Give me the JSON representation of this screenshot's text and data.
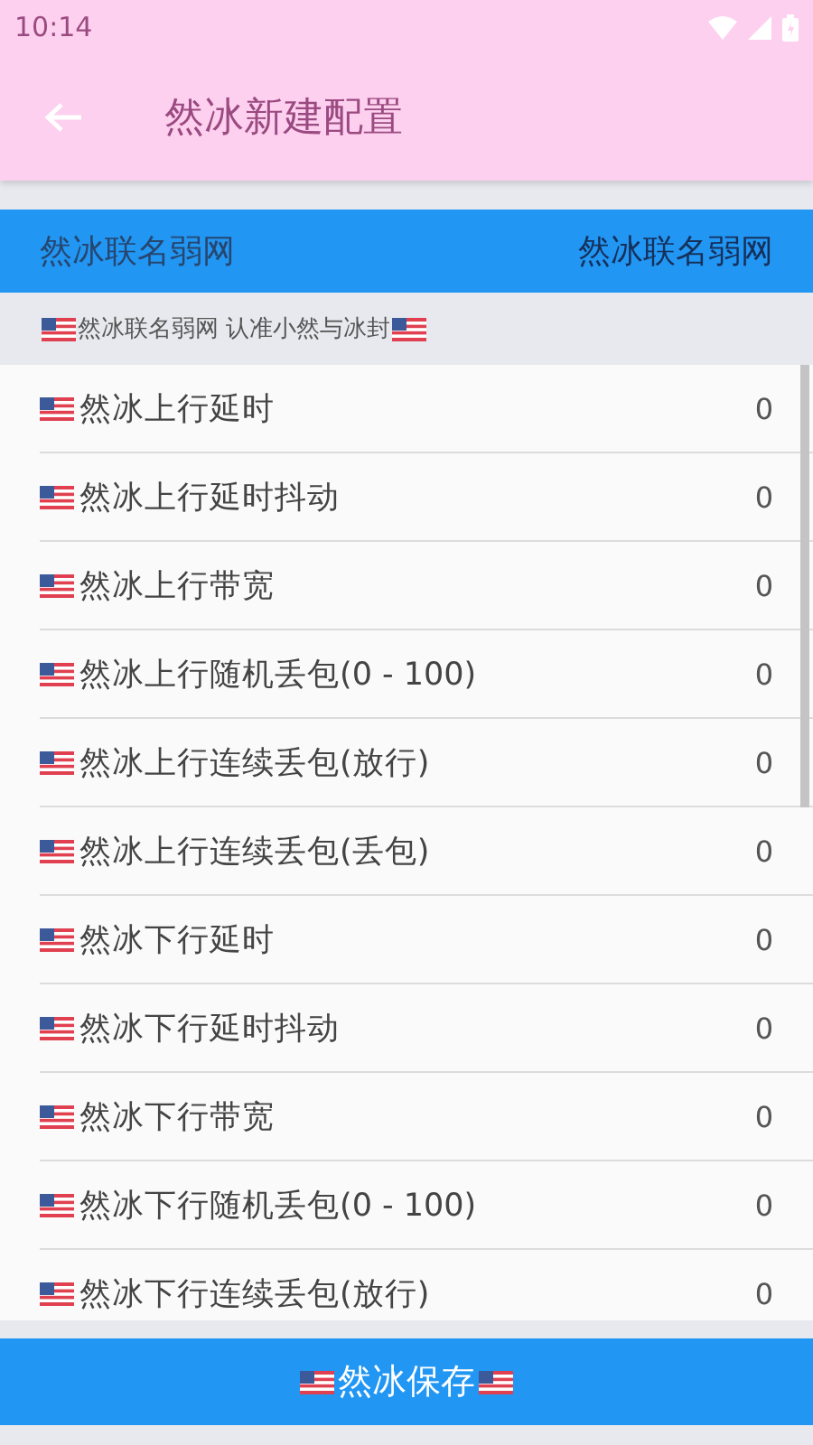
{
  "status_bar": {
    "time": "10:14"
  },
  "app_bar": {
    "title": "然冰新建配置"
  },
  "profile_bar": {
    "label": "然冰联名弱网",
    "value": "然冰联名弱网"
  },
  "notice": {
    "text": "然冰联名弱网 认准小然与冰封"
  },
  "settings": [
    {
      "label": "然冰上行延时",
      "value": "0"
    },
    {
      "label": "然冰上行延时抖动",
      "value": "0"
    },
    {
      "label": "然冰上行带宽",
      "value": "0"
    },
    {
      "label": "然冰上行随机丢包(0 - 100)",
      "value": "0"
    },
    {
      "label": "然冰上行连续丢包(放行)",
      "value": "0"
    },
    {
      "label": "然冰上行连续丢包(丢包)",
      "value": "0"
    },
    {
      "label": "然冰下行延时",
      "value": "0"
    },
    {
      "label": "然冰下行延时抖动",
      "value": "0"
    },
    {
      "label": "然冰下行带宽",
      "value": "0"
    },
    {
      "label": "然冰下行随机丢包(0 - 100)",
      "value": "0"
    },
    {
      "label": "然冰下行连续丢包(放行)",
      "value": "0"
    }
  ],
  "save_button": {
    "label": "然冰保存"
  }
}
